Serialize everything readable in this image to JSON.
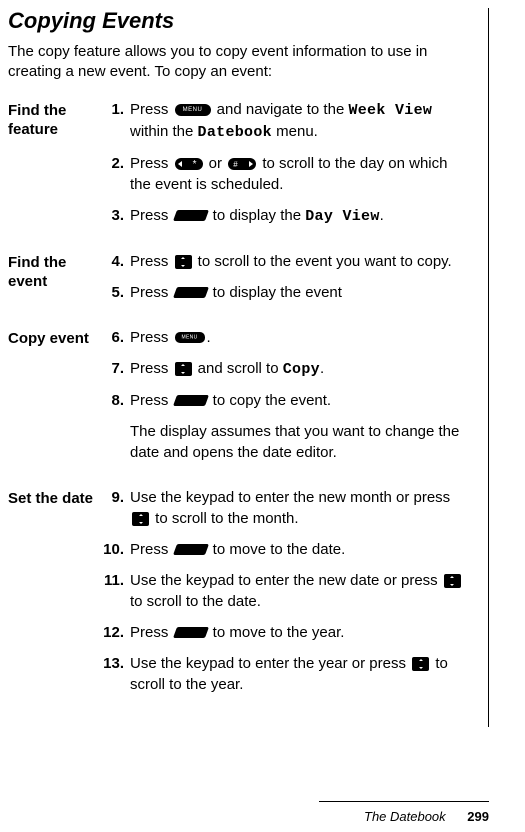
{
  "title": "Copying Events",
  "intro": "The copy feature allows you to copy event information to use in creating a new event. To copy an event:",
  "sections": {
    "find_feature": {
      "label": "Find the feature",
      "step1_a": "Press ",
      "step1_b": " and navigate to the ",
      "step1_c": "Week View",
      "step1_d": " within the ",
      "step1_e": "Datebook",
      "step1_f": " menu.",
      "step2_a": "Press ",
      "step2_b": " or ",
      "step2_c": " to scroll to the day on which the event is scheduled.",
      "step3_a": "Press ",
      "step3_b": " to display the ",
      "step3_c": "Day View",
      "step3_d": "."
    },
    "find_event": {
      "label": "Find the event",
      "step4_a": "Press ",
      "step4_b": " to scroll to the event you want to copy.",
      "step5_a": "Press ",
      "step5_b": " to display the event"
    },
    "copy_event": {
      "label": "Copy event",
      "step6_a": "Press ",
      "step6_b": ".",
      "step7_a": "Press ",
      "step7_b": " and scroll to ",
      "step7_c": "Copy",
      "step7_d": ".",
      "step8_a": "Press ",
      "step8_b": " to copy the event.",
      "step8_extra": "The display assumes that you want to change the date and opens the date editor."
    },
    "set_date": {
      "label": "Set the date",
      "step9_a": "Use the keypad to enter the new month or press ",
      "step9_b": " to scroll to the month.",
      "step10_a": "Press ",
      "step10_b": " to move to the date.",
      "step11_a": "Use the keypad to enter the new date or press ",
      "step11_b": " to scroll to the date.",
      "step12_a": "Press ",
      "step12_b": " to move to the year.",
      "step13_a": "Use the keypad to enter the year or press ",
      "step13_b": " to scroll to the year."
    }
  },
  "footer": {
    "section": "The Datebook",
    "page": "299"
  },
  "step_nums": {
    "n1": "1.",
    "n2": "2.",
    "n3": "3.",
    "n4": "4.",
    "n5": "5.",
    "n6": "6.",
    "n7": "7.",
    "n8": "8.",
    "n9": "9.",
    "n10": "10.",
    "n11": "11.",
    "n12": "12.",
    "n13": "13."
  }
}
